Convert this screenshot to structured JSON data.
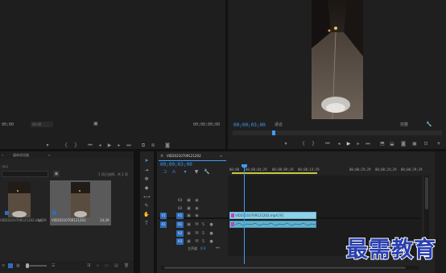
{
  "source_monitor": {
    "timecode_left": "00;00",
    "timecode_right": "00;00;00;00",
    "fit_label": "00.00"
  },
  "program_monitor": {
    "timecode_current": "00;00;03;00",
    "fit": "适合",
    "quality": "完整"
  },
  "project_panel": {
    "tabs": [
      "媒体浏览器"
    ],
    "path": "rpoj",
    "selection_info": "1 项已选择，共 2 项",
    "items": [
      {
        "name": "VID20210709121202.mp4",
        "duration": "14;29"
      },
      {
        "name": "VID20210709121202",
        "duration": "14;29"
      }
    ]
  },
  "timeline": {
    "sequence_name": "VID20210709121202",
    "timecode": "00;00;03;00",
    "ruler_labels": [
      "00;00",
      "00;00;04;29",
      "00;00;09;29",
      "00;00;14;29",
      "00;00;19;29",
      "00;00;24;29",
      "00;00;29;29"
    ],
    "video_tracks": [
      "V3",
      "V2",
      "V1"
    ],
    "audio_tracks": [
      "A1",
      "A2",
      "A3"
    ],
    "master_label": "主声道",
    "master_value": "0.0",
    "video_clip_label": "VID20210709121202.mp4 [V]",
    "audio_clip_label": ""
  },
  "watermark": {
    "text": "最需教育"
  },
  "colors": {
    "accent": "#3f9cf5",
    "clip_video": "#8dd0ea",
    "clip_audio": "#5fb2cf",
    "selected_thumb": "#5a5a5a"
  }
}
